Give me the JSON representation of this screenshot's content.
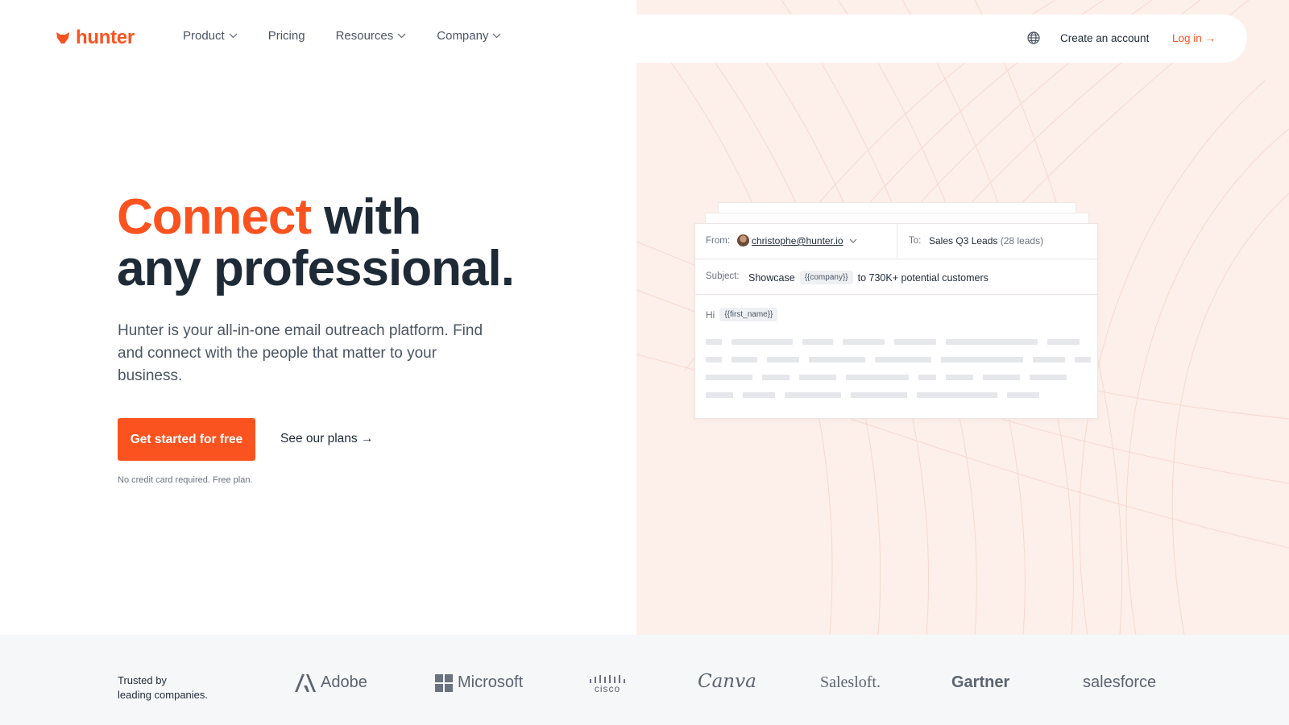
{
  "header": {
    "logo_text": "hunter",
    "nav": [
      {
        "label": "Product",
        "has_dropdown": true
      },
      {
        "label": "Pricing",
        "has_dropdown": false
      },
      {
        "label": "Resources",
        "has_dropdown": true
      },
      {
        "label": "Company",
        "has_dropdown": true
      }
    ],
    "globe_icon": "globe-icon",
    "create_account": "Create an account",
    "login": "Log in →"
  },
  "hero": {
    "headline_accent": "Connect",
    "headline_rest_1": " with",
    "headline_line_2": "any professional.",
    "subtext": "Hunter is your all-in-one email outreach platform. Find and connect with the people that matter to your business.",
    "cta": "Get started for free",
    "secondary_link": "See our plans →",
    "note": "No credit card required. Free plan."
  },
  "email_card": {
    "from_label": "From:",
    "from_email": "christophe@hunter.io",
    "to_label": "To:",
    "to_value": "Sales Q3 Leads",
    "to_count": "(28 leads)",
    "subject_label": "Subject:",
    "subject_prefix": "Showcase",
    "subject_tag": "{{company}}",
    "subject_suffix": "to 730K+ potential customers",
    "greeting": "Hi",
    "greeting_tag": "{{first_name}}"
  },
  "trusted": {
    "line1": "Trusted by",
    "line2": "leading companies.",
    "brands": [
      "Adobe",
      "Microsoft",
      "cisco",
      "Canva",
      "Salesloft.",
      "Gartner",
      "salesforce"
    ]
  },
  "colors": {
    "accent": "#fa5320",
    "text_dark": "#1f2a37",
    "text_muted": "#4b5563",
    "right_bg": "#fdefea",
    "strip_bg": "#f6f7f9"
  }
}
